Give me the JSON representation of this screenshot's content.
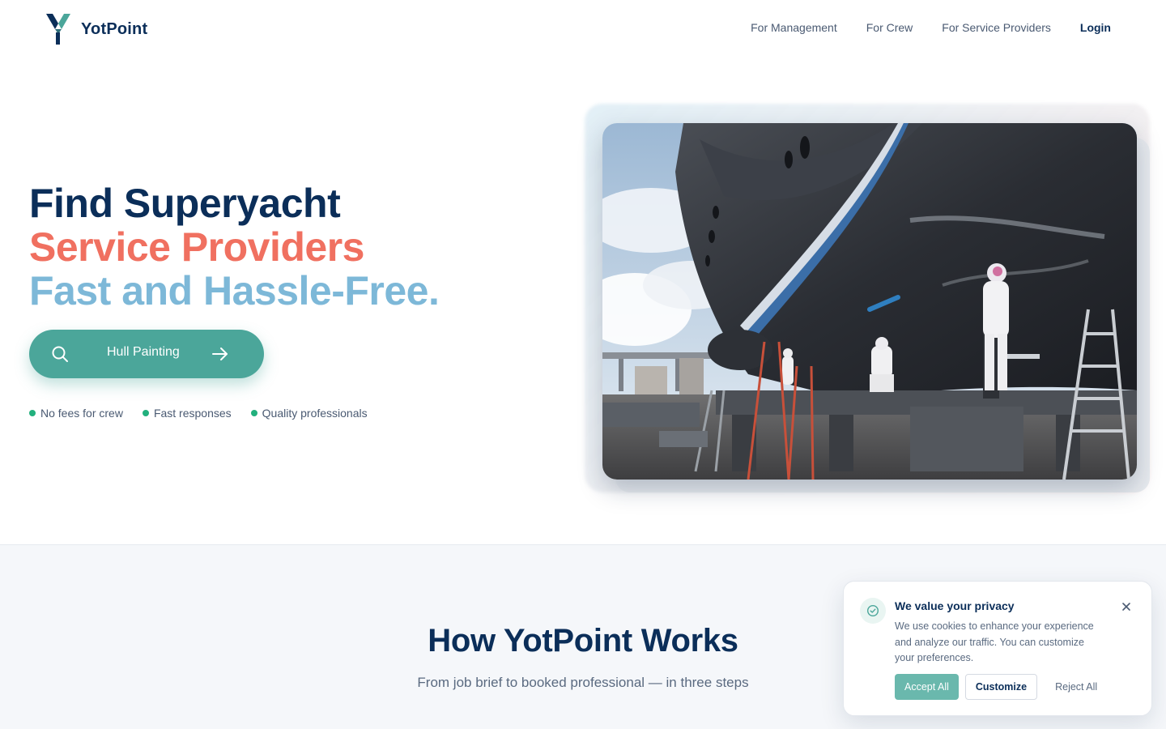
{
  "brand": {
    "name": "YotPoint",
    "primary": "#0b2e59",
    "accent_coral": "#f07060",
    "accent_blue": "#7db8d8",
    "accent_teal": "#4ba69a",
    "status_green": "#22b07d"
  },
  "nav": {
    "items": [
      {
        "label": "For Management"
      },
      {
        "label": "For Crew"
      },
      {
        "label": "For Service Providers"
      },
      {
        "label": "Login"
      }
    ]
  },
  "hero": {
    "line1": "Find Superyacht",
    "line2": "Service Providers",
    "line3": "Fast and Hassle-Free.",
    "search": {
      "value": "Hull Painting",
      "icon": "search-icon",
      "arrow_icon": "arrow-right-icon"
    },
    "features": [
      "No fees for crew",
      "Fast responses",
      "Quality professionals"
    ],
    "image": {
      "alt": "Superyacht hull being painted in dry dock"
    }
  },
  "how": {
    "title": "How YotPoint Works",
    "subtitle": "From job brief to booked professional — in three steps"
  },
  "cookie": {
    "icon": "shield-check-icon",
    "title": "We value your privacy",
    "body": "We use cookies to enhance your experience and analyze our traffic. You can customize your preferences.",
    "accept": "Accept All",
    "customize": "Customize",
    "reject": "Reject All"
  }
}
